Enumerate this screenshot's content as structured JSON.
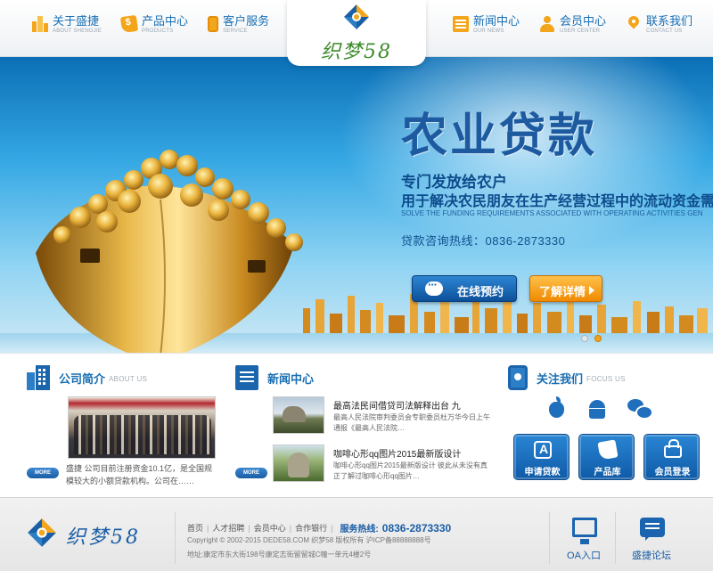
{
  "header": {
    "nav_left": [
      {
        "zh": "关于盛捷",
        "en": "ABOUT SHENGJIE",
        "icon": "building-icon"
      },
      {
        "zh": "产品中心",
        "en": "PRODUCTS",
        "icon": "price-tag-icon"
      },
      {
        "zh": "客户服务",
        "en": "SERVICE",
        "icon": "phone-icon"
      }
    ],
    "logo_text": "织梦58",
    "nav_right": [
      {
        "zh": "新闻中心",
        "en": "OUR NEWS",
        "icon": "newspaper-icon"
      },
      {
        "zh": "会员中心",
        "en": "USER CENTER",
        "icon": "user-icon"
      },
      {
        "zh": "联系我们",
        "en": "CONTACT US",
        "icon": "location-pin-icon"
      }
    ]
  },
  "banner": {
    "title": "农业贷款",
    "subtitle1": "专门发放给农户",
    "subtitle2": "用于解决农民朋友在生产经营过程中的流动资金需求",
    "english": "SOLVE THE FUNDING REQUIREMENTS ASSOCIATED WITH OPERATING ACTIVITIES GEN",
    "hotline": "贷款咨询热线：0836-2873330",
    "btn_book": "在线预约",
    "btn_detail": "了解详情",
    "slide_count": 2,
    "active_slide": 2
  },
  "company": {
    "title": "公司简介",
    "en": "ABOUT US",
    "text": "盛捷 公司目前注册资金10.1亿，是全国规模较大的小额贷款机构。公司在……",
    "more": "MORE"
  },
  "news": {
    "title": "新闻中心",
    "more": "MORE",
    "items": [
      {
        "title": "最高法民间借贷司法解释出台 九",
        "desc": "最高人民法院审判委员会专职委员杜万华今日上午通报《最高人民法院…"
      },
      {
        "title": "咖啡心形qq图片2015最新版设计",
        "desc": "咖啡心形qq图片2015最新版设计 彼此从未没有真正了解过咖啡心形qq图片…"
      }
    ]
  },
  "follow": {
    "title": "关注我们",
    "en": "FOCUS US",
    "social": [
      "apple-icon",
      "android-icon",
      "wechat-icon"
    ],
    "buttons": [
      {
        "label": "申请贷款",
        "icon": "app-store-icon"
      },
      {
        "label": "产品库",
        "icon": "tag-icon"
      },
      {
        "label": "会员登录",
        "icon": "lock-icon"
      }
    ]
  },
  "footer": {
    "logo_text": "织梦58",
    "links": [
      "首页",
      "人才招聘",
      "会员中心",
      "合作银行"
    ],
    "hotline_label": "服务热线:",
    "hotline": "0836-2873330",
    "copyright": "Copyright © 2002-2015 DEDE58.COM 织梦58 版权所有 沪ICP备88888888号",
    "address": "地址:康定市东大街198号康定志街留留城C幢一单元4楼2号",
    "oa_label": "OA入口",
    "forum_label": "盛捷论坛"
  },
  "colors": {
    "primary_blue": "#1a6fb3",
    "accent_orange": "#f3a61b",
    "logo_green": "#3d8a2a"
  }
}
